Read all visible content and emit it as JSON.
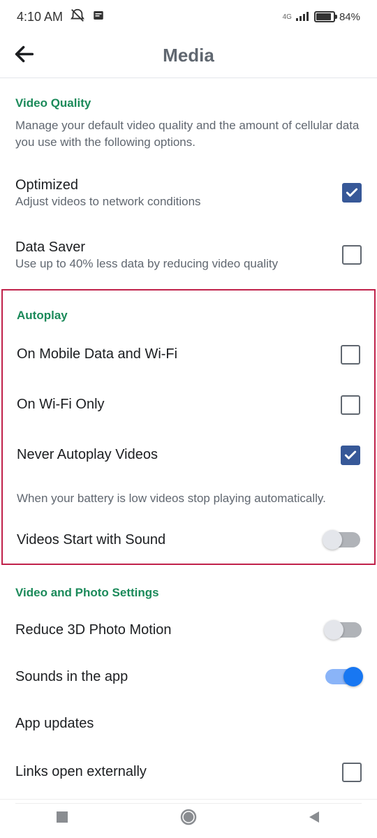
{
  "status": {
    "time": "4:10 AM",
    "network": "4G",
    "battery": "84%"
  },
  "header": {
    "title": "Media"
  },
  "sections": {
    "video_quality": {
      "header": "Video Quality",
      "desc": "Manage your default video quality and the amount of cellular data you use with the following options.",
      "optimized": {
        "title": "Optimized",
        "sub": "Adjust videos to network conditions",
        "checked": true
      },
      "data_saver": {
        "title": "Data Saver",
        "sub": "Use up to 40% less data by reducing video quality",
        "checked": false
      }
    },
    "autoplay": {
      "header": "Autoplay",
      "mobile_wifi": {
        "title": "On Mobile Data and Wi-Fi",
        "checked": false
      },
      "wifi_only": {
        "title": "On Wi-Fi Only",
        "checked": false
      },
      "never": {
        "title": "Never Autoplay Videos",
        "checked": true
      },
      "note": "When your battery is low videos stop playing automatically.",
      "sound": {
        "title": "Videos Start with Sound",
        "on": false
      }
    },
    "video_photo": {
      "header": "Video and Photo Settings",
      "reduce3d": {
        "title": "Reduce 3D Photo Motion",
        "on": false
      },
      "sounds": {
        "title": "Sounds in the app",
        "on": true
      },
      "updates": {
        "title": "App updates"
      },
      "links": {
        "title": "Links open externally",
        "checked": false
      }
    }
  }
}
